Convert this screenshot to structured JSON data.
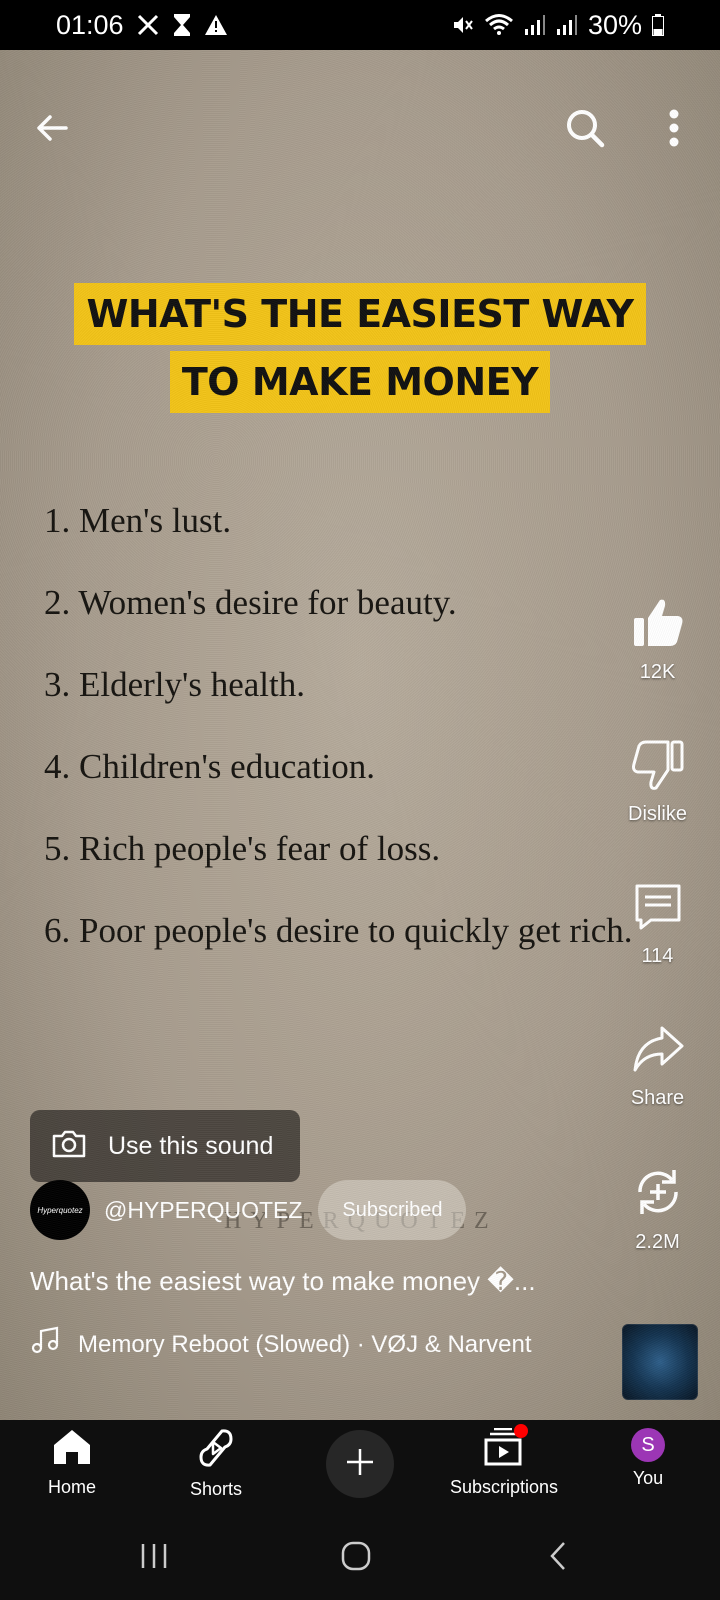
{
  "status_bar": {
    "time": "01:06",
    "battery": "30%",
    "left_icons": [
      "x-logo-icon",
      "hourglass-icon",
      "warning-icon"
    ],
    "right_icons": [
      "mute-icon",
      "wifi-icon",
      "signal-icon",
      "signal-icon",
      "battery-icon"
    ]
  },
  "top_bar": {
    "icons": [
      "back-arrow-icon",
      "search-icon",
      "more-vert-icon"
    ]
  },
  "video": {
    "headline": [
      "WHAT'S THE EASIEST WAY",
      "TO MAKE MONEY"
    ],
    "list": [
      "1. Men's lust.",
      "2. Women's desire for beauty.",
      "3. Elderly's health.",
      "4. Children's education.",
      "5. Rich people's fear of loss.",
      "6. Poor people's desire to quickly get rich."
    ],
    "watermark": "HYPERQUOTEZ"
  },
  "actions": {
    "like_count": "12K",
    "dislike_label": "Dislike",
    "comment_count": "114",
    "share_label": "Share",
    "remix_count": "2.2M"
  },
  "use_sound": {
    "label": "Use this sound"
  },
  "channel": {
    "avatar_text": "Hyperquotez",
    "handle": "@HYPERQUOTEZ",
    "subscribe_label": "Subscribed"
  },
  "video_title": "What's the easiest way to make money �...",
  "music": {
    "track": "Memory Reboot (Slowed) · VØJ & Narvent"
  },
  "bottom_nav": {
    "items": [
      {
        "label": "Home",
        "icon": "home-icon"
      },
      {
        "label": "Shorts",
        "icon": "shorts-icon"
      },
      {
        "label": "",
        "icon": "plus-icon"
      },
      {
        "label": "Subscriptions",
        "icon": "subscriptions-icon"
      },
      {
        "label": "You",
        "icon": "avatar"
      }
    ],
    "you_initial": "S"
  },
  "colors": {
    "headline_bg": "#f2c318",
    "notification_dot": "#ff0000",
    "you_avatar": "#9c36b5"
  }
}
